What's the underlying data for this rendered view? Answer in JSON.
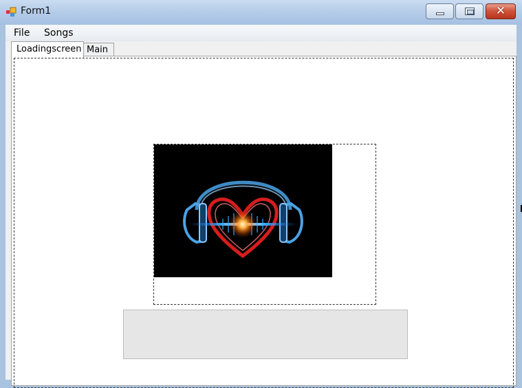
{
  "window": {
    "title": "Form1",
    "icons": {
      "app": "form-app-icon",
      "minimize": "minimize-icon",
      "maximize": "maximize-icon",
      "close": "close-icon"
    },
    "close_glyph": "✕"
  },
  "menu": {
    "items": [
      {
        "label": "File"
      },
      {
        "label": "Songs"
      }
    ]
  },
  "tabs": [
    {
      "label": "Loadingscreen",
      "selected": true
    },
    {
      "label": "Main",
      "selected": false
    }
  ],
  "loading_screen": {
    "image": "heart-headphones-image",
    "progress": 0
  },
  "colors": {
    "heart": "#d61d1d",
    "headphones": "#4aa3e6",
    "glow": "#ffb347",
    "progress_track": "#e6e6e6"
  }
}
